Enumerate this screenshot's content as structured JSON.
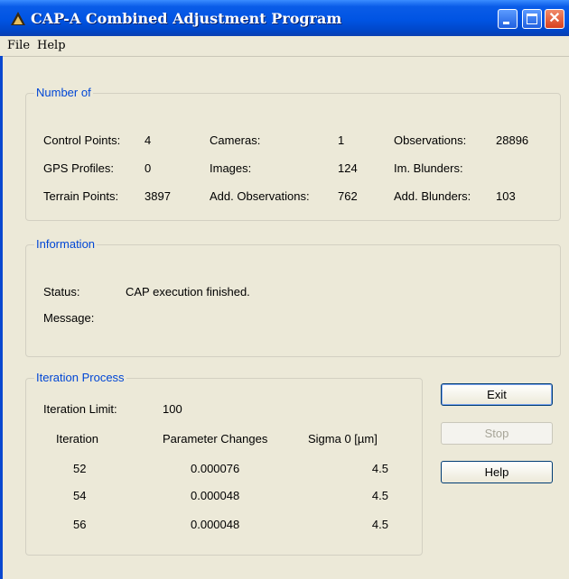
{
  "window": {
    "title": "CAP-A Combined Adjustment Program"
  },
  "menu": {
    "file": "File",
    "help": "Help"
  },
  "number_of": {
    "legend": "Number of",
    "control_points_label": "Control Points:",
    "control_points": "4",
    "gps_profiles_label": "GPS Profiles:",
    "gps_profiles": "0",
    "terrain_points_label": "Terrain Points:",
    "terrain_points": "3897",
    "cameras_label": "Cameras:",
    "cameras": "1",
    "images_label": "Images:",
    "images": "124",
    "add_observations_label": "Add. Observations:",
    "add_observations": "762",
    "observations_label": "Observations:",
    "observations": "28896",
    "im_blunders_label": "Im. Blunders:",
    "im_blunders": "",
    "add_blunders_label": "Add. Blunders:",
    "add_blunders": "103"
  },
  "information": {
    "legend": "Information",
    "status_label": "Status:",
    "status": "CAP execution finished.",
    "message_label": "Message:",
    "message": ""
  },
  "iteration": {
    "legend": "Iteration Process",
    "limit_label": "Iteration Limit:",
    "limit": "100",
    "col_iteration": "Iteration",
    "col_param": "Parameter Changes",
    "col_sigma": "Sigma 0 [µm]",
    "rows": [
      {
        "iteration": "52",
        "param": "0.000076",
        "sigma": "4.5"
      },
      {
        "iteration": "54",
        "param": "0.000048",
        "sigma": "4.5"
      },
      {
        "iteration": "56",
        "param": "0.000048",
        "sigma": "4.5"
      }
    ]
  },
  "buttons": {
    "exit": "Exit",
    "stop": "Stop",
    "help": "Help"
  }
}
